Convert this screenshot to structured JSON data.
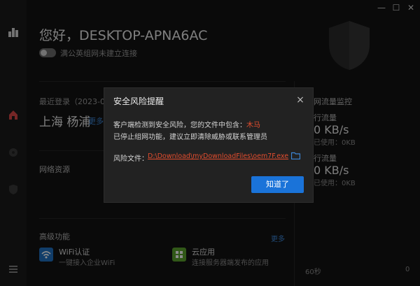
{
  "window": {
    "minimize_glyph": "—",
    "maximize_glyph": "☐",
    "close_glyph": "✕"
  },
  "rail": {
    "icons": [
      "city-buildings-icon",
      "home-icon",
      "compass-icon",
      "shield-icon",
      "menu-icon"
    ],
    "accent_color": "#d64545"
  },
  "header": {
    "greeting": "您好，DESKTOP-APNA6AC",
    "vpn_status": "满公英组网未建立连接"
  },
  "login": {
    "label": "最近登录（2023-08-",
    "location": "上海 杨浦",
    "more": "更多"
  },
  "network": {
    "title": "网络资源"
  },
  "advanced": {
    "title": "高级功能",
    "more": "更多",
    "items": [
      {
        "title": "WiFi认证",
        "subtitle": "一键接入企业WiFi",
        "icon": "wifi-icon",
        "color": "#1f6fbf"
      },
      {
        "title": "云应用",
        "subtitle": "连接服务器端发布的应用",
        "icon": "grid-icon",
        "color": "#5aa02c"
      }
    ]
  },
  "traffic": {
    "title": "网流量监控",
    "upload_label": "行流量",
    "upload_speed": "0 KB/s",
    "upload_used": "已使用：0KB",
    "download_label": "行流量",
    "download_speed": "0 KB/s",
    "download_used": "已使用：0KB",
    "axis_start": "60秒",
    "axis_end": "0"
  },
  "dialog": {
    "title": "安全风险提醒",
    "close_glyph": "×",
    "line1_prefix": "客户端检测到安全风险，您的文件中包含：",
    "threat_name": "木马",
    "line2": "已停止组网功能，建议立即清除威胁或联系管理员",
    "file_label": "风险文件：",
    "file_path": "D:\\Download\\myDownloadFiles\\oem7F.exe",
    "ok_button": "知道了",
    "accent_color": "#1a73d9",
    "danger_color": "#e34d2e"
  }
}
